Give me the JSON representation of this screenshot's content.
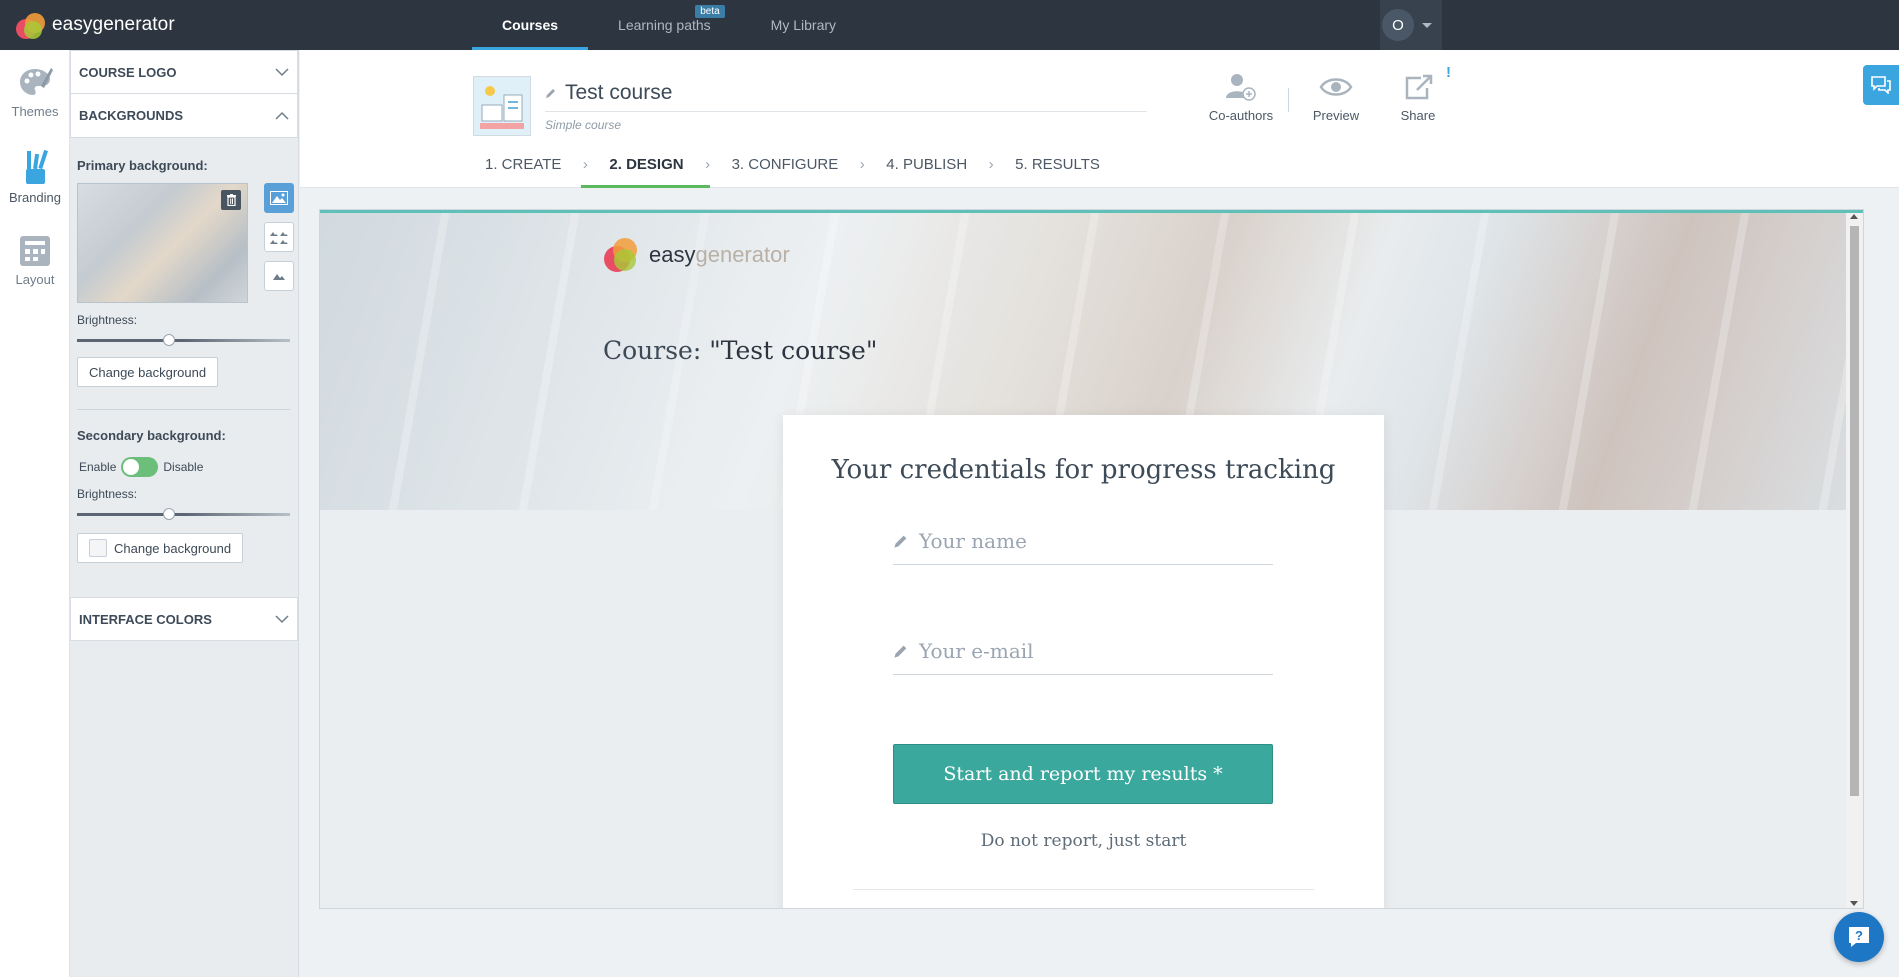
{
  "app": {
    "name": "easygenerator"
  },
  "topnav": {
    "items": [
      {
        "label": "Courses",
        "active": true
      },
      {
        "label": "Learning paths",
        "badge": "beta"
      },
      {
        "label": "My Library"
      }
    ]
  },
  "user": {
    "initial": "O"
  },
  "rail": {
    "items": [
      {
        "label": "Themes",
        "icon": "palette-icon"
      },
      {
        "label": "Branding",
        "icon": "brushes-icon",
        "active": true
      },
      {
        "label": "Layout",
        "icon": "layout-grid-icon"
      }
    ]
  },
  "panel": {
    "course_logo": "COURSE LOGO",
    "backgrounds": "BACKGROUNDS",
    "primary_label": "Primary background:",
    "brightness_label": "Brightness:",
    "primary_brightness": 0.43,
    "change_background": "Change background",
    "secondary_label": "Secondary background:",
    "enable": "Enable",
    "disable": "Disable",
    "secondary_brightness": 0.43,
    "interface_colors": "INTERFACE COLORS"
  },
  "course": {
    "title": "Test course",
    "subtitle": "Simple course"
  },
  "actions": {
    "coauthors": "Co-authors",
    "preview": "Preview",
    "share": "Share",
    "share_alert": "!"
  },
  "steps": [
    "1. CREATE",
    "2. DESIGN",
    "3. CONFIGURE",
    "4. PUBLISH",
    "5. RESULTS"
  ],
  "preview": {
    "logo_part1": "easy",
    "logo_part2": "generator",
    "course_prefix": "Course: ",
    "course_name": "\"Test course\"",
    "card_title": "Your credentials for progress tracking",
    "name_placeholder": "Your name",
    "email_placeholder": "Your e-mail",
    "start_button": "Start and report my results *",
    "no_report": "Do not report, just start"
  },
  "colors": {
    "topbar": "#2d3540",
    "accent": "#3ba5e0",
    "design_underline": "#5cb85c",
    "start_button": "#3aa89c",
    "toggle_on": "#6cbf7b"
  }
}
